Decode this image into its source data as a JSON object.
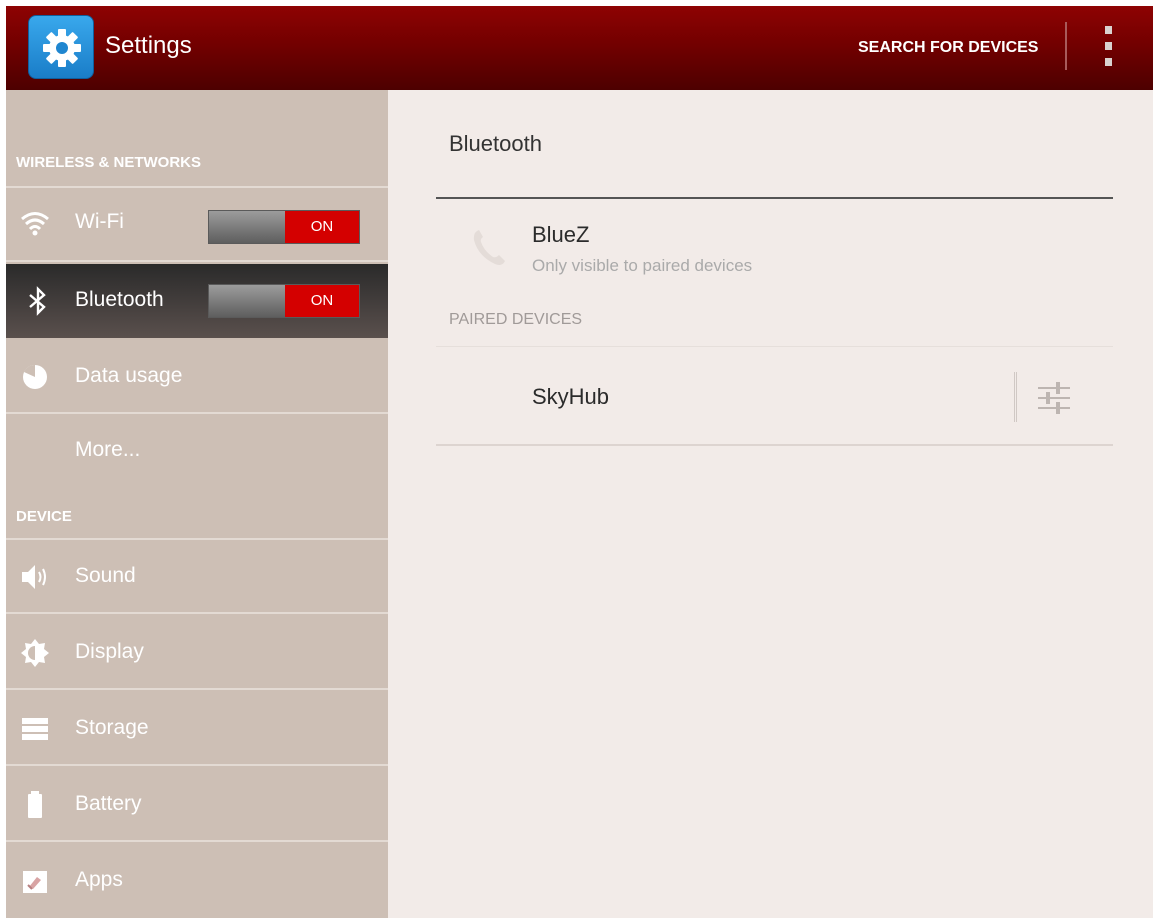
{
  "app": {
    "title": "Settings",
    "icon": "gear-icon"
  },
  "actionbar": {
    "search_label": "SEARCH FOR DEVICES",
    "overflow_icon": "overflow-menu-icon"
  },
  "sidebar": {
    "sections": [
      {
        "header": "WIRELESS & NETWORKS"
      },
      {
        "header": "DEVICE"
      }
    ],
    "items": [
      {
        "label": "Wi-Fi",
        "icon": "wifi-icon",
        "toggle": "ON",
        "selected": false
      },
      {
        "label": "Bluetooth",
        "icon": "bluetooth-icon",
        "toggle": "ON",
        "selected": true
      },
      {
        "label": "Data usage",
        "icon": "data-usage-icon",
        "selected": false
      },
      {
        "label": "More...",
        "selected": false
      },
      {
        "label": "Sound",
        "icon": "speaker-icon",
        "selected": false
      },
      {
        "label": "Display",
        "icon": "brightness-icon",
        "selected": false
      },
      {
        "label": "Storage",
        "icon": "storage-icon",
        "selected": false
      },
      {
        "label": "Battery",
        "icon": "battery-icon",
        "selected": false
      },
      {
        "label": "Apps",
        "icon": "apps-icon",
        "selected": false
      }
    ]
  },
  "main": {
    "title": "Bluetooth",
    "this_device": {
      "name": "BlueZ",
      "subtitle": "Only visible to paired devices",
      "icon": "phone-icon"
    },
    "paired_header": "PAIRED DEVICES",
    "paired_devices": [
      {
        "name": "SkyHub",
        "settings_icon": "settings-sliders-icon"
      }
    ]
  },
  "colors": {
    "actionbar": "#730000",
    "sidebar": "#cdbfb5",
    "content": "#f2ebe8",
    "toggle_on": "#d40000"
  }
}
